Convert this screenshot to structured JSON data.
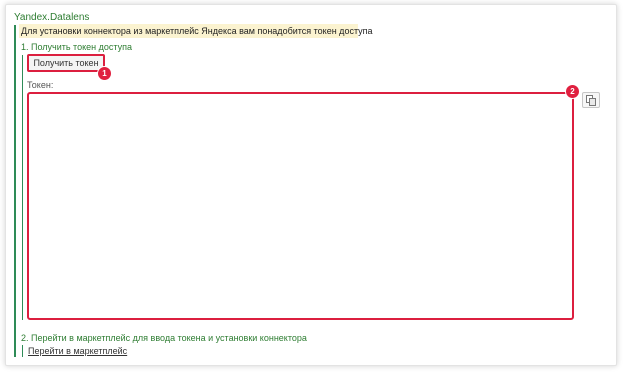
{
  "group": {
    "title": "Yandex.Datalens",
    "notice": "Для установки коннектора из маркетплейс Яндекса вам понадобится токен доступа"
  },
  "step1": {
    "title": "1. Получить токен доступа",
    "button_label": "Получить токен",
    "token_label": "Токен:",
    "token_value": ""
  },
  "step2": {
    "title": "2. Перейти в маркетплейс для ввода токена и установки коннектора",
    "link_label": "Перейти в маркетплейс"
  },
  "markers": {
    "one": "1",
    "two": "2"
  },
  "icons": {
    "copy": "copy-icon"
  },
  "colors": {
    "accent_green": "#2e7d32",
    "highlight_red": "#dc1f3f",
    "notice_background": "#fbf3d0"
  }
}
